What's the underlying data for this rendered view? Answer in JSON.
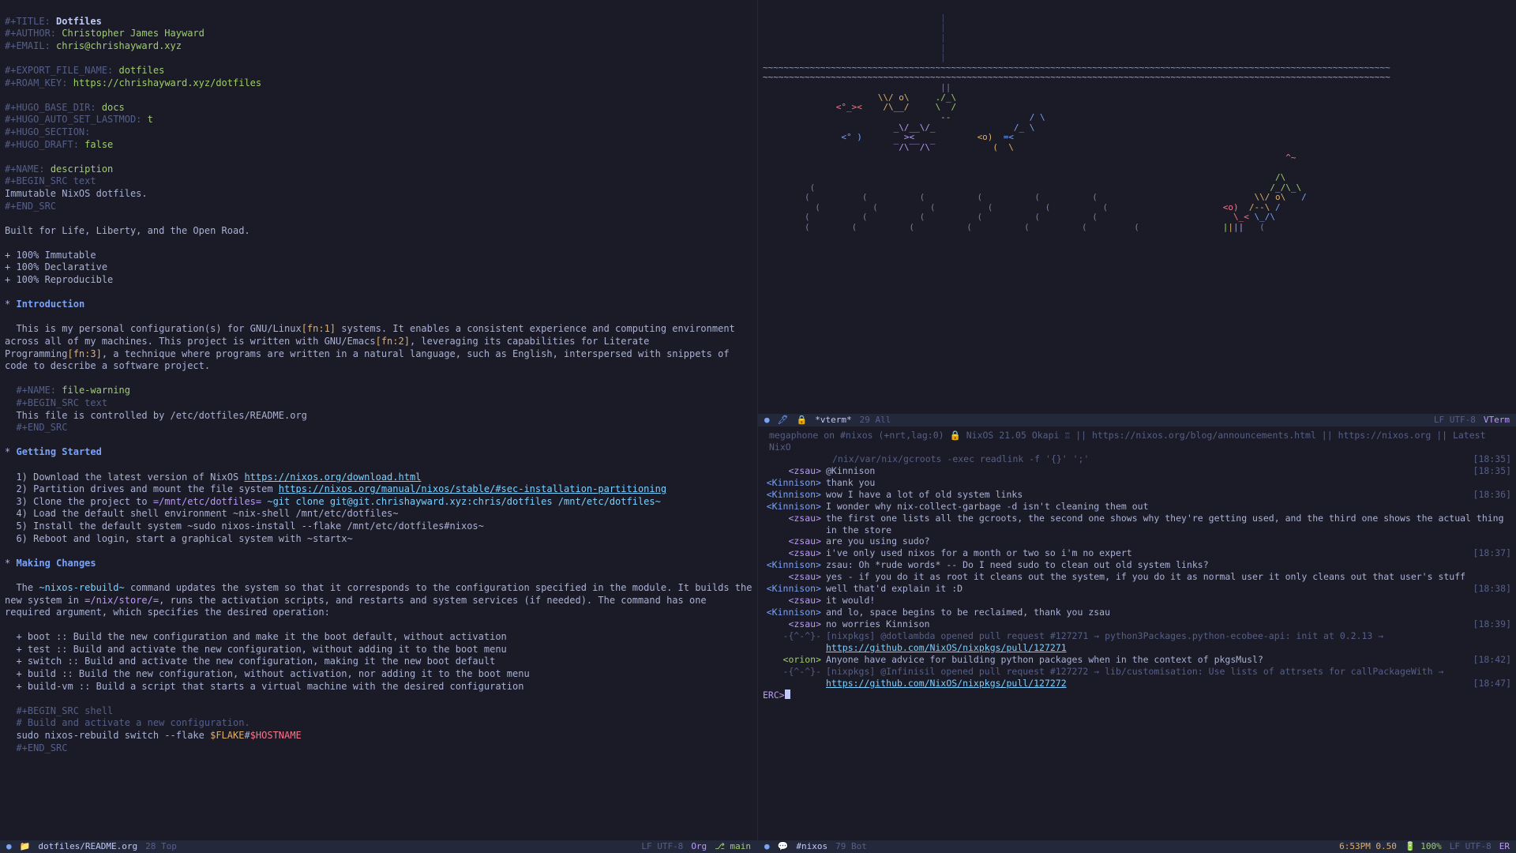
{
  "org": {
    "meta": {
      "title_kw": "#+TITLE:",
      "title": "Dotfiles",
      "author_kw": "#+AUTHOR:",
      "author": "Christopher James Hayward",
      "email_kw": "#+EMAIL:",
      "email": "chris@chrishayward.xyz",
      "export_kw": "#+EXPORT_FILE_NAME:",
      "export": "dotfiles",
      "roam_kw": "#+ROAM_KEY:",
      "roam": "https://chrishayward.xyz/dotfiles",
      "hugo_base_kw": "#+HUGO_BASE_DIR:",
      "hugo_base": "docs",
      "hugo_lastmod_kw": "#+HUGO_AUTO_SET_LASTMOD:",
      "hugo_lastmod": "t",
      "hugo_section_kw": "#+HUGO_SECTION:",
      "hugo_draft_kw": "#+HUGO_DRAFT:",
      "hugo_draft": "false",
      "name_kw": "#+NAME:",
      "name_desc": "description",
      "begin_src_text": "#+BEGIN_SRC text",
      "desc_body": "Immutable NixOS dotfiles.",
      "end_src": "#+END_SRC",
      "tagline": "Built for Life, Liberty, and the Open Road.",
      "bullet1": "+ 100% Immutable",
      "bullet2": "+ 100% Declarative",
      "bullet3": "+ 100% Reproducible"
    },
    "intro": {
      "heading": "Introduction",
      "p1a": "This is my personal configuration(s) for GNU/Linux",
      "fn1": "[fn:1]",
      "p1b": " systems. It enables a consistent experience and computing environment across all of my machines. This project is written with GNU/Emacs",
      "fn2": "[fn:2]",
      "p1c": ", leveraging its capabilities for Literate Programming",
      "fn3": "[fn:3]",
      "p1d": ", a technique where programs are written in a natural language, such as English, interspersed with snippets of code to describe a software project.",
      "name_warn": "file-warning",
      "warn_body": "This file is controlled by /etc/dotfiles/README.org"
    },
    "getting_started": {
      "heading": "Getting Started",
      "l1a": "1) Download the latest version of NixOS ",
      "l1b": "https://nixos.org/download.html",
      "l2a": "2) Partition drives and mount the file system ",
      "l2b": "https://nixos.org/manual/nixos/stable/#sec-installation-partitioning",
      "l3a": "3) Clone the project to ",
      "l3b": "=/mnt/etc/dotfiles=",
      "l3c": " ~git clone git@git.chrishayward.xyz:chris/dotfiles /mnt/etc/dotfiles~",
      "l4": "4) Load the default shell environment ~nix-shell /mnt/etc/dotfiles~",
      "l5": "5) Install the default system ~sudo nixos-install --flake /mnt/etc/dotfiles#nixos~",
      "l6": "6) Reboot and login, start a graphical system with ~startx~"
    },
    "making_changes": {
      "heading": "Making Changes",
      "p1a": "The ",
      "p1b": "~nixos-rebuild~",
      "p1c": " command updates the system so that it corresponds to the configuration specified in the module. It builds the new system in ",
      "p1d": "=/nix/store/=",
      "p1e": ", runs the activation scripts, and restarts and system services (if needed). The command has one required argument, which specifies the desired operation:",
      "b1": "+ boot :: Build the new configuration and make it the boot default, without activation",
      "b2": "+ test :: Build and activate the new configuration, without adding it to the boot menu",
      "b3": "+ switch :: Build and activate the new configuration, making it the new boot default",
      "b4": "+ build :: Build the new configuration, without activation, nor adding it to the boot menu",
      "b5": "+ build-vm :: Build a script that starts a virtual machine with the desired configuration",
      "src_shell": "#+BEGIN_SRC shell",
      "src_comment": "# Build and activate a new configuration.",
      "src_cmd_a": "sudo nixos-rebuild switch --flake ",
      "src_cmd_b": "$FLAKE",
      "src_cmd_c": "#",
      "src_cmd_d": "$HOSTNAME"
    }
  },
  "modeline_left": {
    "file": "dotfiles/README.org",
    "pos": "28 Top",
    "enc": "LF UTF-8",
    "mode": "Org",
    "branch": "main"
  },
  "vterm_modeline": {
    "buffer": "*vterm*",
    "pos": "29 All",
    "enc": "LF UTF-8",
    "mode": "VTerm"
  },
  "irc": {
    "topic1": "megaphone on #nixos (+nrt,lag:0) ",
    "topic2": " NixOS 21.05 Okapi ",
    "topic3": " || https://nixos.org/blog/announcements.html || https://nixos.org || Latest NixO",
    "topic4": "/nix/var/nix/gcroots -exec readlink -f '{}' ';'",
    "lines": [
      {
        "nick": "<zsau>",
        "cls": "irc-nick",
        "msg": "@Kinnison",
        "time": "[18:35]"
      },
      {
        "nick": "<Kinnison>",
        "cls": "irc-nick2",
        "msg": "thank you",
        "time": ""
      },
      {
        "nick": "<Kinnison>",
        "cls": "irc-nick2",
        "msg": "wow I have a lot of old system links",
        "time": "[18:36]"
      },
      {
        "nick": "<Kinnison>",
        "cls": "irc-nick2",
        "msg": "I wonder why nix-collect-garbage -d isn't cleaning them out",
        "time": ""
      },
      {
        "nick": "<zsau>",
        "cls": "irc-nick",
        "msg": "the first one lists all the gcroots, the second one shows why they're getting used, and the third one shows the actual thing in the store",
        "time": ""
      },
      {
        "nick": "<zsau>",
        "cls": "irc-nick",
        "msg": "are you using sudo?",
        "time": ""
      },
      {
        "nick": "<zsau>",
        "cls": "irc-nick",
        "msg": "i've only used nixos for a month or two so i'm no expert",
        "time": "[18:37]"
      },
      {
        "nick": "<Kinnison>",
        "cls": "irc-nick2",
        "msg": "zsau: Oh *rude words* -- Do I need sudo to clean out old system links?",
        "time": ""
      },
      {
        "nick": "<zsau>",
        "cls": "irc-nick",
        "msg": "yes - if you do it as root it cleans out the system, if you do it as normal user it only cleans out that user's stuff",
        "time": ""
      },
      {
        "nick": "<Kinnison>",
        "cls": "irc-nick2",
        "msg": "well that'd explain it :D",
        "time": "[18:38]"
      },
      {
        "nick": "<zsau>",
        "cls": "irc-nick",
        "msg": "it would!",
        "time": ""
      },
      {
        "nick": "<Kinnison>",
        "cls": "irc-nick2",
        "msg": "and lo, space begins to be reclaimed, thank you zsau",
        "time": ""
      },
      {
        "nick": "<zsau>",
        "cls": "irc-nick",
        "msg": "no worries Kinnison",
        "time": "[18:39]"
      }
    ],
    "bot1a": "-{^-^}-",
    "bot1b": "[nixpkgs] @dotlambda opened pull request #127271 → python3Packages.python-ecobee-api: init at 0.2.13 →",
    "bot1link": "https://github.com/NixOS/nixpkgs/pull/127271",
    "orion_nick": "<orion>",
    "orion_msg": "Anyone have advice for building python packages when in the context of pkgsMusl?",
    "orion_time": "[18:42]",
    "bot2a": "-{^-^}-",
    "bot2b": "[nixpkgs] @Infinisil opened pull request #127272 → lib/customisation: Use lists of attrsets for callPackageWith →",
    "bot2link": "https://github.com/NixOS/nixpkgs/pull/127272",
    "bot2time": "[18:47]",
    "prompt": "ERC>"
  },
  "irc_modeline": {
    "buffer": "#nixos",
    "pos": "79 Bot",
    "time": "6:53PM 0.50",
    "batt": "100%",
    "enc": "LF UTF-8",
    "mode": "ER"
  },
  "ascii": {
    "pipe": "                                  |",
    "tildes": "~~~~~~~~~~~~~~~~~~~~~~~~~~~~~~~~~~~~~~~~~~~~~~~~~~~~~~~~~~~~~~~~~~~~~~~~~~~~~~~~~~~~~~~~~~~~~~~~~~~~~~~~~~~~~~~~~~~~~~~~"
  }
}
